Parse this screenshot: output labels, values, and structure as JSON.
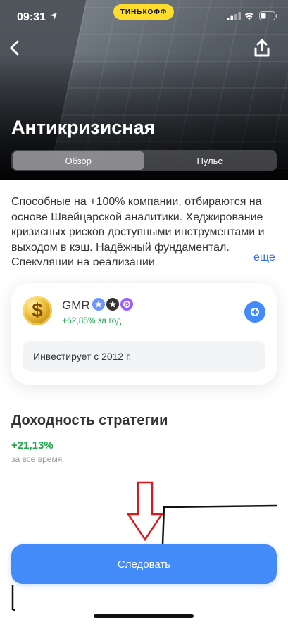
{
  "status_bar": {
    "time": "09:31",
    "bank_badge": "ТИНЬКОФФ"
  },
  "header": {
    "title": "Антикризисная",
    "back_icon": "chevron-left-icon",
    "share_icon": "share-icon",
    "tabs": [
      {
        "label": "Обзор",
        "active": true
      },
      {
        "label": "Пульс",
        "active": false
      }
    ]
  },
  "description": {
    "text": "Способные на +100% компании, отбираются на основе Швейцарской аналитики. Хеджирование кризисных рисков доступными инструментами и выходом в кэш. Надёжный фундаментал. Спекуляции на реализации",
    "more_label": "еще"
  },
  "author": {
    "avatar_icon": "gold-dollar-coin-icon",
    "name": "GMR",
    "badge_icons": [
      "star-badge-icon",
      "star-badge-dark-icon",
      "premium-badge-icon"
    ],
    "yield_text": "+62,85% за год",
    "follow_icon": "plus-icon",
    "investing_since": "Инвестирует с 2012 г."
  },
  "returns": {
    "title": "Доходность стратегии",
    "value": "+21,13%",
    "caption": "за все время"
  },
  "follow_button": {
    "label": "Следовать"
  },
  "colors": {
    "accent": "#428bf9",
    "positive": "#1fa84b",
    "bank_yellow": "#ffdd2d",
    "annotation_arrow": "#e0161d"
  }
}
